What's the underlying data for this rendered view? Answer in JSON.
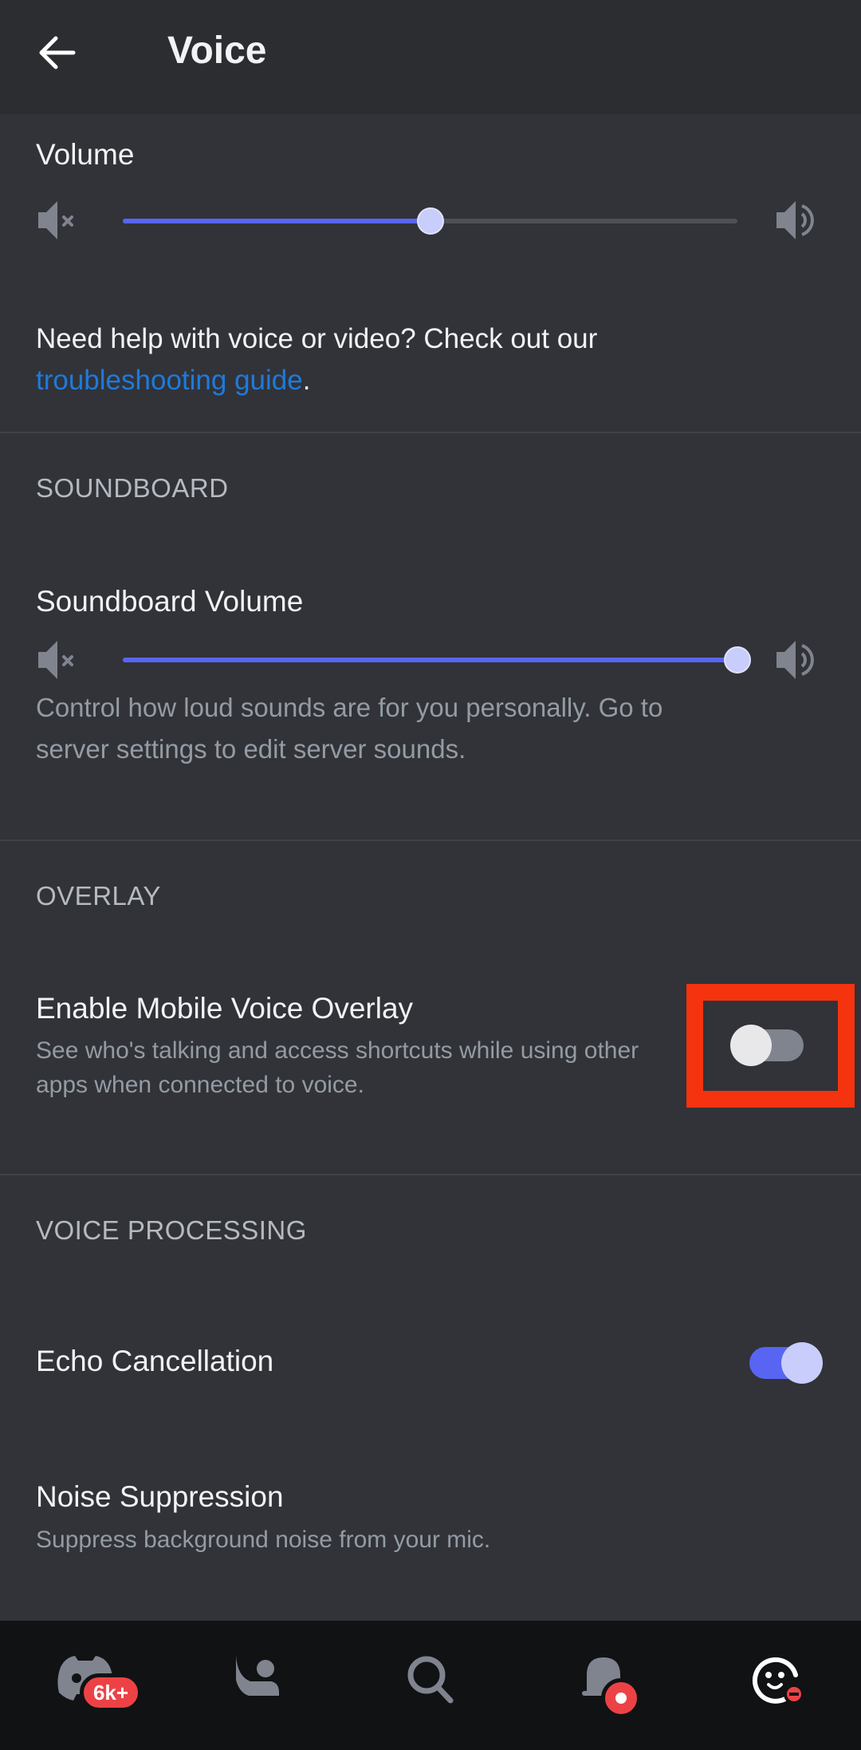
{
  "header": {
    "title": "Voice",
    "back_icon": "arrow-left-icon"
  },
  "volume": {
    "label": "Volume",
    "value_percent": 50,
    "min_icon": "speaker-muted-icon",
    "max_icon": "speaker-loud-icon"
  },
  "help": {
    "text": "Need help with voice or video? Check out our",
    "link": "troubleshooting guide",
    "suffix": "."
  },
  "soundboard": {
    "section": "SOUNDBOARD",
    "label": "Soundboard Volume",
    "value_percent": 100,
    "description_line1": "Control how loud sounds are for you personally. Go to",
    "description_line2": "server settings to edit server sounds."
  },
  "overlay": {
    "section": "OVERLAY",
    "title": "Enable Mobile Voice Overlay",
    "description_line1": "See who's talking and access shortcuts while using other",
    "description_line2": "apps when connected to voice.",
    "enabled": false
  },
  "voice_processing": {
    "section": "VOICE PROCESSING",
    "echo": {
      "title": "Echo Cancellation",
      "enabled": true
    },
    "noise": {
      "title": "Noise Suppression",
      "description": "Suppress background noise from your mic."
    }
  },
  "nav": {
    "items": [
      {
        "name": "servers",
        "icon": "discord-logo-icon",
        "badge": "6k+"
      },
      {
        "name": "friends",
        "icon": "friends-wave-icon"
      },
      {
        "name": "search",
        "icon": "search-icon"
      },
      {
        "name": "notifications",
        "icon": "bell-icon",
        "badge": "dot"
      },
      {
        "name": "profile",
        "icon": "avatar-icon",
        "status": "do-not-disturb"
      }
    ]
  },
  "colors": {
    "accent": "#5865f2",
    "link": "#1f7adb",
    "highlight": "#f5330f",
    "badge": "#ed4245"
  }
}
